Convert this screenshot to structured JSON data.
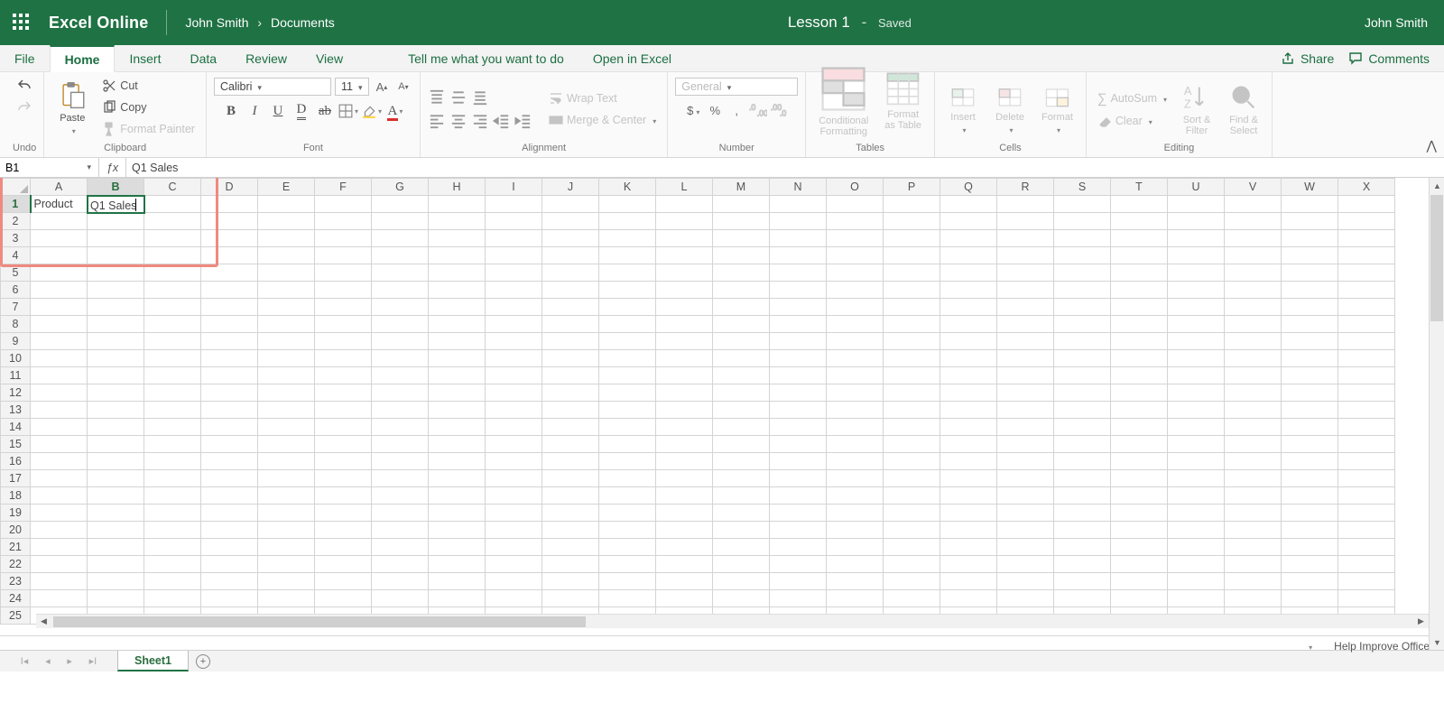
{
  "title": {
    "app": "Excel Online",
    "user_left": "John Smith",
    "bc_sep": "›",
    "bc_loc": "Documents",
    "doc": "Lesson 1",
    "dash": "-",
    "status": "Saved",
    "user_right": "John Smith"
  },
  "tabs": {
    "file": "File",
    "home": "Home",
    "insert": "Insert",
    "data": "Data",
    "review": "Review",
    "view": "View",
    "tellme": "Tell me what you want to do",
    "open_excel": "Open in Excel",
    "share": "Share",
    "comments": "Comments"
  },
  "ribbon": {
    "undo": "Undo",
    "paste": "Paste",
    "cut": "Cut",
    "copy": "Copy",
    "fmtpaint": "Format Painter",
    "g_clipboard": "Clipboard",
    "font_name": "Calibri",
    "font_size": "11",
    "g_font": "Font",
    "wrap": "Wrap Text",
    "merge": "Merge & Center",
    "g_align": "Alignment",
    "nf_general": "General",
    "g_number": "Number",
    "condfmt": "Conditional\nFormatting",
    "asTable": "Format\nas Table",
    "g_tables": "Tables",
    "ins": "Insert",
    "del": "Delete",
    "fmt": "Format",
    "g_cells": "Cells",
    "autosum": "AutoSum",
    "clear": "Clear",
    "sortf": "Sort &\nFilter",
    "findsel": "Find &\nSelect",
    "g_edit": "Editing"
  },
  "formula": {
    "cellref": "B1",
    "value": "Q1 Sales"
  },
  "grid": {
    "cols": [
      "A",
      "B",
      "C",
      "D",
      "E",
      "F",
      "G",
      "H",
      "I",
      "J",
      "K",
      "L",
      "M",
      "N",
      "O",
      "P",
      "Q",
      "R",
      "S",
      "T",
      "U",
      "V",
      "W",
      "X"
    ],
    "rows": 25,
    "active_col": "B",
    "active_row": 1,
    "cells": {
      "A1": "Product",
      "B1": "Q1 Sales"
    }
  },
  "sheet": {
    "name": "Sheet1"
  },
  "status": {
    "help": "Help Improve Office"
  }
}
